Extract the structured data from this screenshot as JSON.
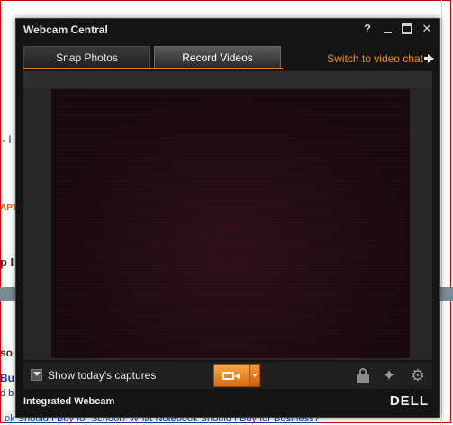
{
  "background_page": {
    "fragment_l": "- L",
    "fragment_apt": "APT",
    "fragment_p": "p I",
    "fragment_so": "so",
    "fragment_bu": "Bu",
    "fragment_d": "d b",
    "fragment_links": "ok Should I Buy for School?   What Notebook Should I Buy for Business?"
  },
  "window": {
    "title": "Webcam Central",
    "help_label": "?",
    "close_label": "✕"
  },
  "tabs": [
    {
      "label": "Snap Photos",
      "active": false
    },
    {
      "label": "Record Videos",
      "active": true
    }
  ],
  "switch_link": "Switch to video chat",
  "footer": {
    "show_captures_label": "Show today's captures",
    "device_name": "Integrated Webcam",
    "brand": "DELL"
  },
  "colors": {
    "accent": "#f0901e",
    "window_bg": "#141414"
  }
}
